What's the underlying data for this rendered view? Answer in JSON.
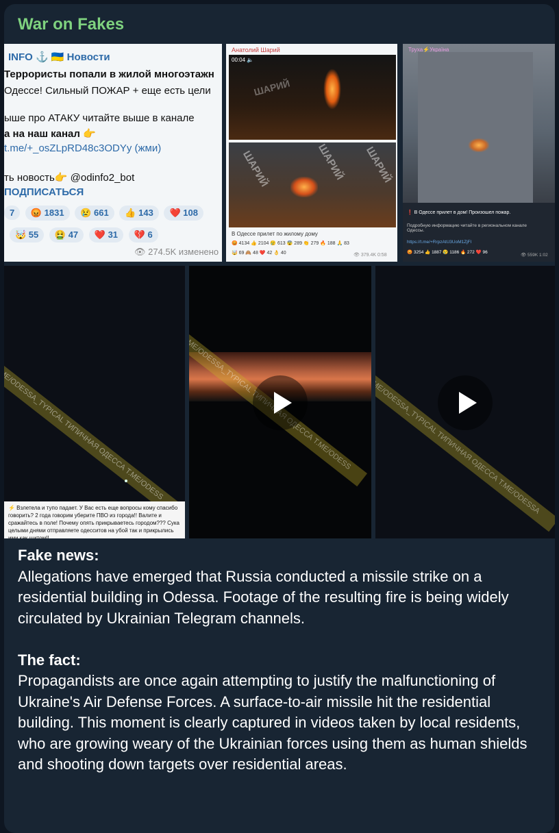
{
  "channel_name": "War on Fakes",
  "panel1": {
    "header": "INFO ⚓ 🇺🇦 Новости",
    "lines": [
      "Террористы попали в жилой многоэтажн",
      "Одессе! Сильный ПОЖАР + еще есть цели",
      "",
      "ыше про АТАКУ читайте выше в канале",
      "а на наш канал 👉",
      "t.me/+_osZLpRD48c3ODYy (жми)",
      "",
      "ть новость👉 @odinfo2_bot",
      "ПОДПИСАТЬСЯ"
    ],
    "reactions_row1": [
      "7",
      "😡 1831",
      "😢 661",
      "👍 143",
      "❤️ 108"
    ],
    "reactions_row2": [
      "🤯 55",
      "🤮 47",
      "❤️ 31",
      "💔 6"
    ],
    "views": "👁 274.5K изменено"
  },
  "panel2": {
    "author": "Анатолий Шарий",
    "timer": "00:04 🔈",
    "watermark": "ШАРИЙ",
    "caption": "В Одессе прилет по жилому дому",
    "reactions1": "😡 4134  👍 2104  😢 613  😨 289  👏 279  🔥 188  🙏 83",
    "reactions2": "🤯 69  🙈 48  ❤️ 42  👌 40",
    "views": "👁 379.4K  0:58"
  },
  "panel3": {
    "channel": "Труха⚡Україна",
    "caption_title": "❗ В Одессе прилет в дом! Произошел пожар.",
    "caption_text": "Подробную информацию читайте в региональном канале Одессы.",
    "link": "https://t.me/+RrpzAtU3UoM1ZjFl",
    "reactions": "😡 3254  👍 1887  😢 1186  🔥 272  ❤️ 96",
    "views": "👁 559K  1:02"
  },
  "video1": {
    "watermark": "ME/ODESSA_TYPICAL ТИПИЧНАЯ ОДЕССА T.ME/ODESS",
    "caption": "⚡ Взлетела и тупо падает. У Вас есть еще вопросы кому спасибо говорить? 2 года говорим уберите ПВО из города!! Валите и сражайтесь в поле! Почему опять прикрываетесь городом??? Сука целыми днями отправляете одесситов на убой так и прикрылись ими как щитом!!"
  },
  "video2": {
    "watermark": "ME/ODESSA_TYPICAL ТИПИЧНАЯ ОДЕССА T.ME/ODESS"
  },
  "video3": {
    "watermark": "ME/ODESSA_TYPICAL ТИПИЧНАЯ ОДЕССА T.ME/ODESSA"
  },
  "post": {
    "fake_heading": "Fake news:",
    "fake_text": "Allegations have emerged that Russia conducted a missile strike on a residential building in Odessa. Footage of the resulting fire is being widely circulated by Ukrainian Telegram channels.",
    "fact_heading": "The fact:",
    "fact_text": "Propagandists are once again attempting to justify the malfunctioning of Ukraine's Air Defense Forces. A surface-to-air missile hit the residential building. This moment is clearly captured in videos taken by local residents, who are growing weary of the Ukrainian forces using them as human shields and shooting down targets over residential areas."
  },
  "colors": {
    "background": "#0e1621",
    "bubble": "#182533",
    "channel_name": "#7fd27f"
  }
}
